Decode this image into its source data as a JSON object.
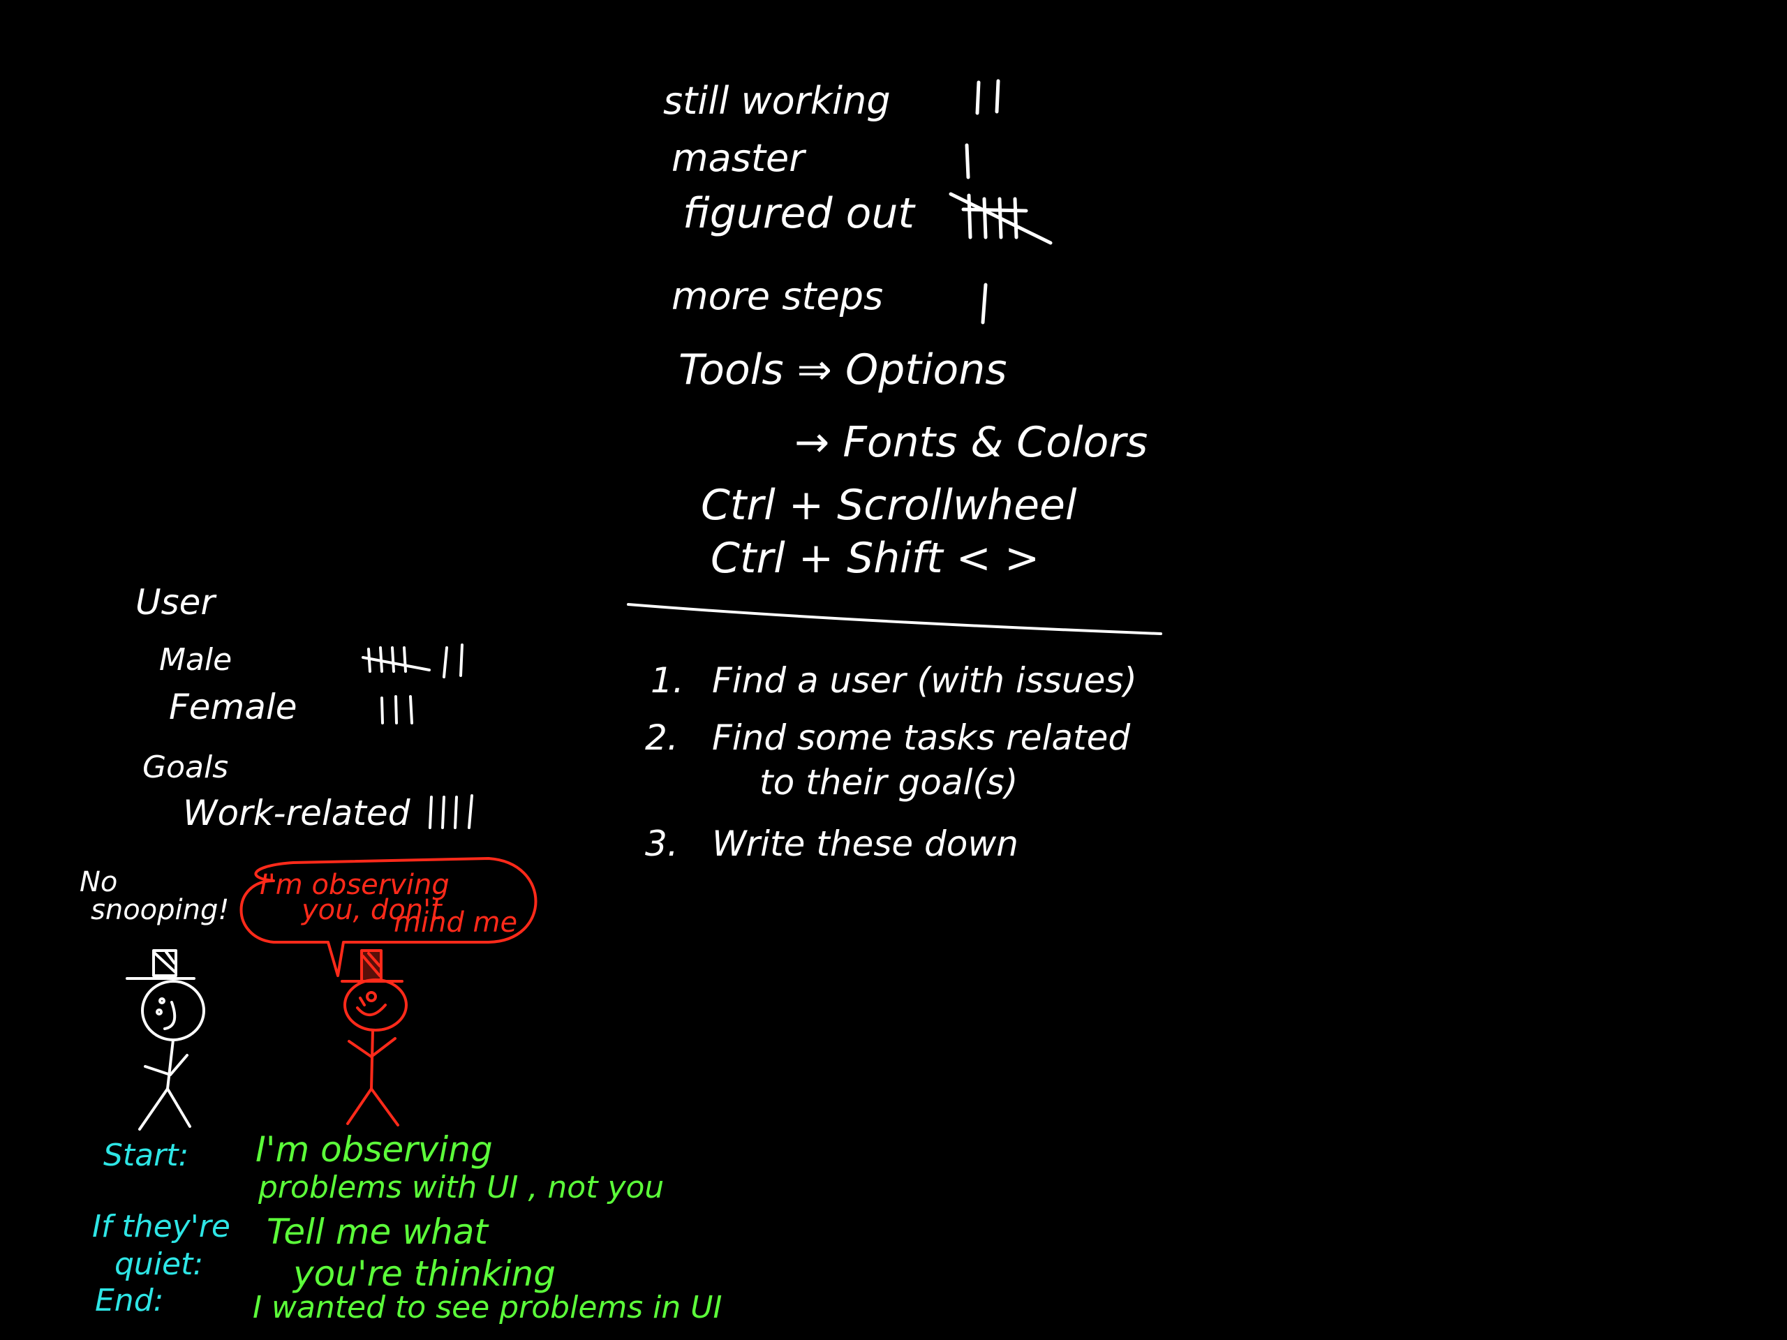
{
  "colors": {
    "background": "#000000",
    "white_ink": "#ffffff",
    "red_ink": "#ff2a1a",
    "green_ink": "#5cff3a",
    "cyan_ink": "#2ee6e6"
  },
  "tally_notes": {
    "still_working": {
      "label": "still working",
      "count": 2
    },
    "master": {
      "label": "master",
      "count": 1
    },
    "figured_out": {
      "label": "figured out",
      "count": 5
    },
    "more_steps": {
      "label": "more steps",
      "count": 1
    }
  },
  "font_tips": {
    "tools": "Tools ⇒ Options",
    "fonts": "→ Fonts & Colors",
    "ctrl_scroll": "Ctrl + Scrollwheel",
    "ctrl_shift": "Ctrl + Shift <   >"
  },
  "steps": [
    {
      "num": "1.",
      "text": "Find  a  user  (with issues)"
    },
    {
      "num": "2.",
      "text": "Find  some tasks related"
    },
    {
      "num": "",
      "text": "to their goal(s)"
    },
    {
      "num": "3.",
      "text": "Write  these  down"
    }
  ],
  "user_stats": {
    "heading": "User",
    "male": {
      "label": "Male",
      "count": 7
    },
    "female": {
      "label": "Female",
      "count": 3
    },
    "goals_heading": "Goals",
    "work_related": {
      "label": "Work-related",
      "count": 4
    }
  },
  "cartoon": {
    "white_speech": "No\nsnooping!",
    "white_speech_line1": "No",
    "white_speech_line2": "snooping!",
    "red_bubble_line1": "I'm observing",
    "red_bubble_line2": "you, don't",
    "red_bubble_line3": "mind me"
  },
  "script": {
    "start_label": "Start:",
    "start_text_line1": "I'm  observing",
    "start_text_line2": "problems with UI ,  not you",
    "quiet_label_line1": "If they're",
    "quiet_label_line2": "quiet:",
    "quiet_text_line1": "Tell  me  what",
    "quiet_text_line2": "you're  thinking",
    "end_label": "End:",
    "end_text": "I wanted to see problems in UI"
  }
}
